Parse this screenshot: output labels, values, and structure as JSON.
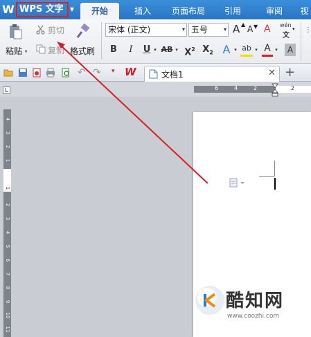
{
  "app": {
    "logo_glyph": "W",
    "menu_label": "WPS 文字",
    "menu_arrow": "▼"
  },
  "tabs": [
    {
      "label": "开始",
      "active": true
    },
    {
      "label": "插入",
      "active": false
    },
    {
      "label": "页面布局",
      "active": false
    },
    {
      "label": "引用",
      "active": false
    },
    {
      "label": "审阅",
      "active": false
    },
    {
      "label": "视",
      "active": false
    }
  ],
  "ribbon": {
    "paste_label": "粘贴",
    "cut_label": "剪切",
    "copy_label": "复制",
    "format_painter_label": "格式刷",
    "font_name": "宋体 (正文)",
    "font_size": "五号",
    "grow_font": "A",
    "shrink_font": "A",
    "clear_format": "A",
    "pinyin": "wén",
    "bold": "B",
    "italic": "I",
    "underline": "U",
    "strike": "AB",
    "superscript": "X",
    "subscript": "X",
    "text_effect": "A",
    "highlight": "ab",
    "font_color": "A",
    "char_shade": "A",
    "dropdown_glyph": "▾"
  },
  "quickbar": {
    "doc_tab_name": "文档1",
    "close_glyph": "✕",
    "new_tab_glyph": "+"
  },
  "ruler": {
    "h_numbers": [
      "6",
      "4",
      "2",
      "2"
    ],
    "v_numbers_top": [
      "4",
      "3",
      "2",
      "1"
    ],
    "v_numbers_bottom": [
      "1",
      "2",
      "3",
      "4",
      "5",
      "6",
      "7",
      "8",
      "9",
      "10",
      "11"
    ]
  },
  "watermark": {
    "brand": "酷知网",
    "url": "www.coozhi.com"
  },
  "colors": {
    "title_blue": "#2a74c4",
    "annotation_red": "#d42020",
    "wps_red": "#d21f25"
  }
}
